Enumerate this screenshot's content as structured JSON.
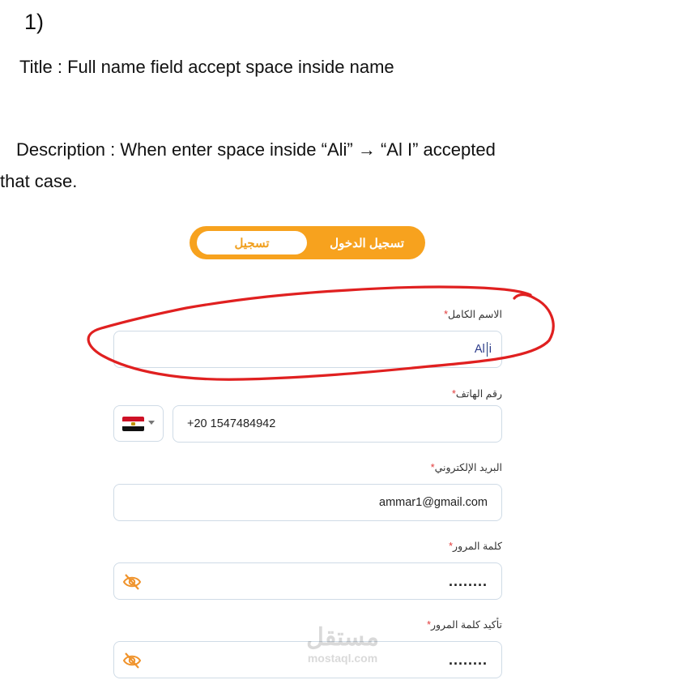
{
  "doc": {
    "number": "1)",
    "title": "Title : Full name field accept space inside name",
    "description_line1": "Description : When  enter  space inside “Ali” → “Al I” accepted",
    "description_line2": "that case."
  },
  "auth_toggle": {
    "login_label": "تسجيل الدخول",
    "register_label": "تسجيل",
    "selected": "register"
  },
  "form": {
    "full_name": {
      "label": "الاسم الكامل",
      "value_before_cursor": "Al",
      "value_after_cursor": "i"
    },
    "phone": {
      "label": "رقم الهاتف",
      "country": "Egypt",
      "value": "+20 1547484942"
    },
    "email": {
      "label": "البريد الإلكتروني",
      "value": "ammar1@gmail.com"
    },
    "password": {
      "label": "كلمة المرور",
      "value": "........",
      "icon": "eye-off-icon"
    },
    "confirm_password": {
      "label": "تأكيد كلمة المرور",
      "value": "........",
      "icon": "eye-off-icon"
    },
    "required_mark": "*"
  },
  "watermark": {
    "arabic": "مستقل",
    "latin": "mostaql.com"
  },
  "colors": {
    "accent": "#f7a21e",
    "annotation": "#e02020",
    "field_border": "#cfdbe6",
    "required": "#e23b3b"
  }
}
